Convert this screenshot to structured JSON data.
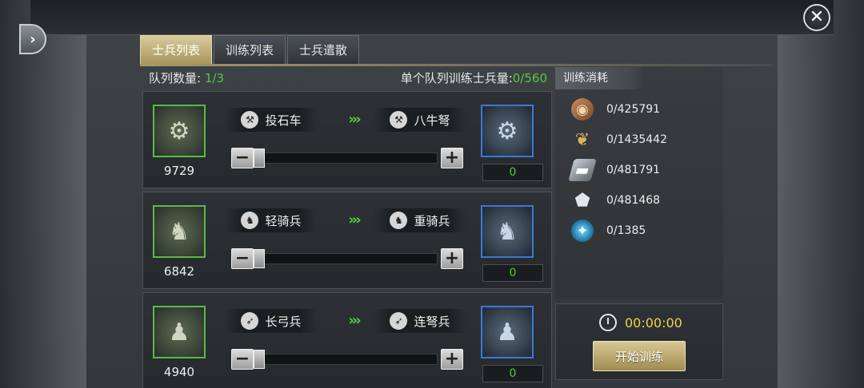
{
  "tabs": [
    "士兵列表",
    "训练列表",
    "士兵遣散"
  ],
  "active_tab": 0,
  "info": {
    "queue_label": "队列数量:",
    "queue_value": "1/3",
    "per_queue_label": "单个队列训练士兵量:",
    "per_queue_value": "0/560"
  },
  "rows": [
    {
      "source_name": "投石车",
      "target_name": "八牛弩",
      "source_count": "9729",
      "quantity": "0",
      "source_icon": "catapult-icon",
      "target_icon": "ballista-icon",
      "type_icon": "siege-type-icon"
    },
    {
      "source_name": "轻骑兵",
      "target_name": "重骑兵",
      "source_count": "6842",
      "quantity": "0",
      "source_icon": "light-cavalry-icon",
      "target_icon": "heavy-cavalry-icon",
      "type_icon": "cavalry-type-icon"
    },
    {
      "source_name": "长弓兵",
      "target_name": "连弩兵",
      "source_count": "4940",
      "quantity": "0",
      "source_icon": "longbowman-icon",
      "target_icon": "crossbowman-icon",
      "type_icon": "archer-type-icon"
    }
  ],
  "cost": {
    "title": "训练消耗",
    "items": [
      {
        "icon": "wood-icon",
        "value": "0/425791"
      },
      {
        "icon": "grain-icon",
        "value": "0/1435442"
      },
      {
        "icon": "iron-icon",
        "value": "0/481791"
      },
      {
        "icon": "stone-icon",
        "value": "0/481468"
      },
      {
        "icon": "gem-icon",
        "value": "0/1385"
      }
    ]
  },
  "training": {
    "timer": "00:00:00",
    "start_label": "开始训练"
  },
  "colors": {
    "accent_green": "#57c93f",
    "timer_yellow": "#f2d24a",
    "tab_gold": "#d9cb9c"
  }
}
